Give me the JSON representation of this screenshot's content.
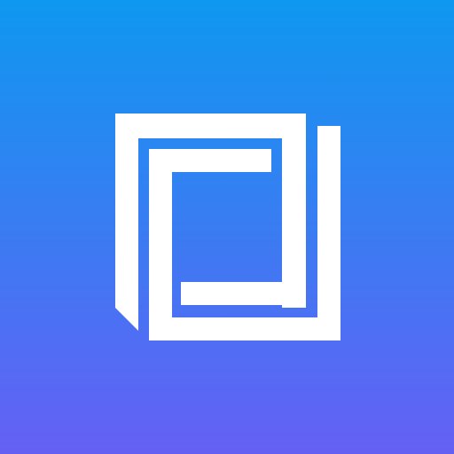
{
  "icon": {
    "name": "app-logo-icon",
    "shape": "nested-square-frames",
    "colors": {
      "gradient_top": "#0E98F0",
      "gradient_bottom": "#6560F4",
      "glyph": "#FFFFFF"
    }
  }
}
